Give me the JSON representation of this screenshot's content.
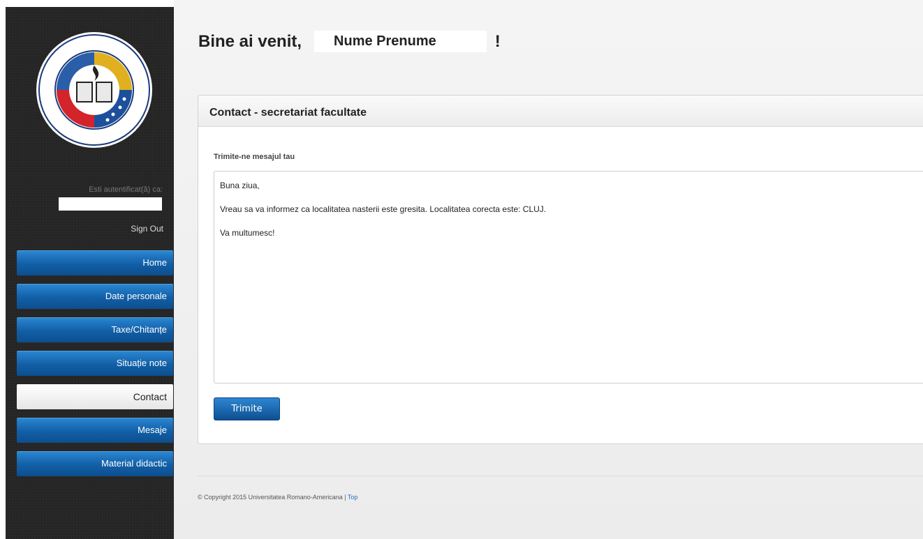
{
  "sidebar": {
    "logo_alt": "UNIVERSITATEA ROMANO-AMERICANA",
    "auth_label": "Esti autentificat(ă) ca:",
    "signout_label": "Sign Out",
    "nav": [
      {
        "label": "Home"
      },
      {
        "label": "Date personale"
      },
      {
        "label": "Taxe/Chitanțe"
      },
      {
        "label": "Situație note"
      },
      {
        "label": "Contact"
      },
      {
        "label": "Mesaje"
      },
      {
        "label": "Material didactic"
      }
    ],
    "active_index": 4
  },
  "header": {
    "welcome": "Bine ai venit,",
    "user_name": "Nume Prenume",
    "exclaim": "!"
  },
  "panel": {
    "title": "Contact - secretariat facultate",
    "field_label": "Trimite-ne mesajul tau",
    "message_lines": [
      "Buna ziua,",
      "Vreau sa va informez ca localitatea nasterii este gresita. Localitatea corecta este: CLUJ.",
      "Va multumesc!"
    ],
    "send_label": "Trimite"
  },
  "footer": {
    "copyright": "© Copyright 2015 Universitatea Romano-Americana |",
    "top_link": "Top"
  },
  "colors": {
    "sidebar_bg": "#252525",
    "nav_blue": "#125fa6",
    "button_blue": "#0d4f91",
    "link_blue": "#2a6fb8"
  }
}
